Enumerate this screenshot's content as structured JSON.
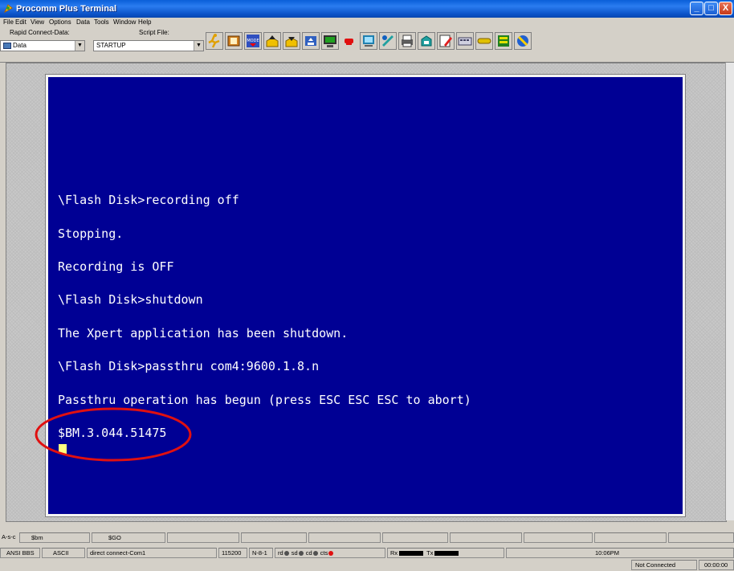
{
  "window": {
    "title": "Procomm Plus Terminal",
    "minimize": "_",
    "maximize": "□",
    "close": "X"
  },
  "menu": [
    "File",
    "Edit",
    "View",
    "Options",
    "Data",
    "Tools",
    "Window",
    "Help"
  ],
  "toolbar": {
    "rapid_connect_label": "Rapid Connect-Data:",
    "rapid_connect_value": "Data",
    "script_label": "Script File:",
    "script_value": "STARTUP",
    "tool_icons": [
      "runner-icon",
      "phonebook-icon",
      "mode-icon",
      "upload-icon",
      "download-icon",
      "receive-icon",
      "monitor-icon",
      "red-phone-icon",
      "terminal-icon",
      "capture-icon",
      "printer-icon",
      "tray-icon",
      "edit-icon",
      "keyboard-icon",
      "hangup-icon",
      "setup-icon",
      "help-icon"
    ]
  },
  "terminal": {
    "lines": [
      "\\Flash Disk>recording off",
      "Stopping.",
      "Recording is OFF",
      "\\Flash Disk>shutdown",
      "The Xpert application has been shutdown.",
      "\\Flash Disk>passthru com4:9600.1.8.n",
      "Passthru operation has begun (press ESC ESC ESC to abort)",
      "$BM.3.044.51475"
    ],
    "background": "#000094",
    "text_color": "#ffffff",
    "cursor_color": "#ffff80",
    "highlight_color": "#e01010"
  },
  "status_top": {
    "cells": [
      "A-s-c",
      "$bm",
      "$GO"
    ]
  },
  "status_bottom": {
    "emulation": "ANSI BBS",
    "transfer": "ASCII",
    "connection": "direct connect-Com1",
    "baud": "115200",
    "parity": "N-8-1",
    "rd": "rd",
    "sd": "sd",
    "cd": "cd",
    "cts": "cts",
    "rx": "Rx",
    "tx": "Tx",
    "time": "10:06PM"
  },
  "status_tail": {
    "state": "Not Connected",
    "elapsed": "00:00:00"
  }
}
